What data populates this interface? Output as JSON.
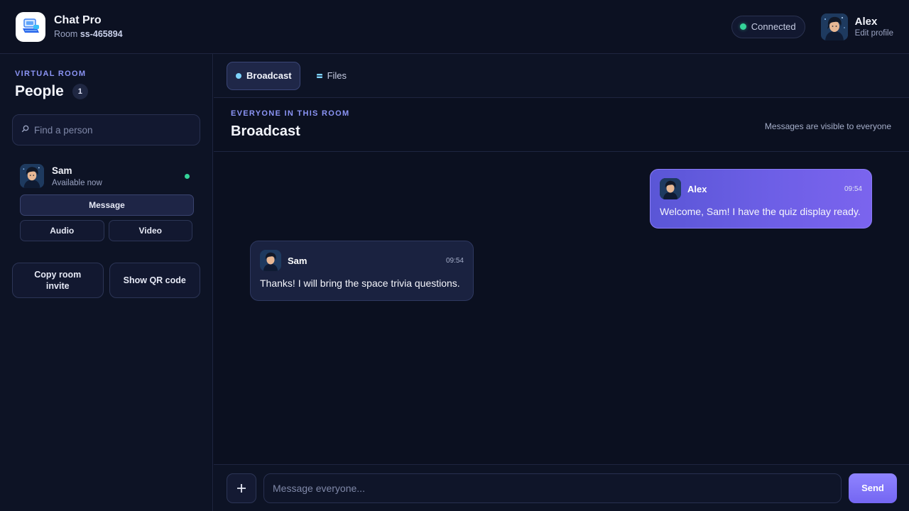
{
  "app": {
    "name": "Chat Pro",
    "room_prefix": "Room",
    "room_id": "ss-465894",
    "logo_icon": "laptop-chat-icon"
  },
  "header": {
    "status": "Connected",
    "status_color": "#34d399",
    "user_name": "Alex",
    "edit_profile": "Edit profile"
  },
  "sidebar": {
    "eyebrow": "VIRTUAL ROOM",
    "title": "People",
    "count": "1",
    "search_placeholder": "Find a person",
    "people": [
      {
        "name": "Sam",
        "status": "Available now",
        "online": true,
        "message_label": "Message",
        "audio_label": "Audio",
        "video_label": "Video"
      }
    ],
    "copy_invite_label": "Copy room invite",
    "qr_label": "Show QR code"
  },
  "tabs": [
    {
      "label": "Broadcast",
      "active": true,
      "icon": "dot-icon"
    },
    {
      "label": "Files",
      "active": false,
      "icon": "file-icon"
    }
  ],
  "section": {
    "eyebrow": "EVERYONE IN THIS ROOM",
    "title": "Broadcast",
    "note": "Messages are visible to everyone"
  },
  "messages": [
    {
      "author": "Alex",
      "time": "09:54",
      "text": "Welcome, Sam! I have the quiz display ready.",
      "mine": true
    },
    {
      "author": "Sam",
      "time": "09:54",
      "text": "Thanks! I will bring the space trivia questions.",
      "mine": false
    }
  ],
  "composer": {
    "placeholder": "Message everyone...",
    "send_label": "Send",
    "attach_icon": "plus-icon"
  },
  "colors": {
    "accent": "#8b94f5",
    "background": "#0b1020",
    "own_bubble": "#6d5fe6"
  }
}
